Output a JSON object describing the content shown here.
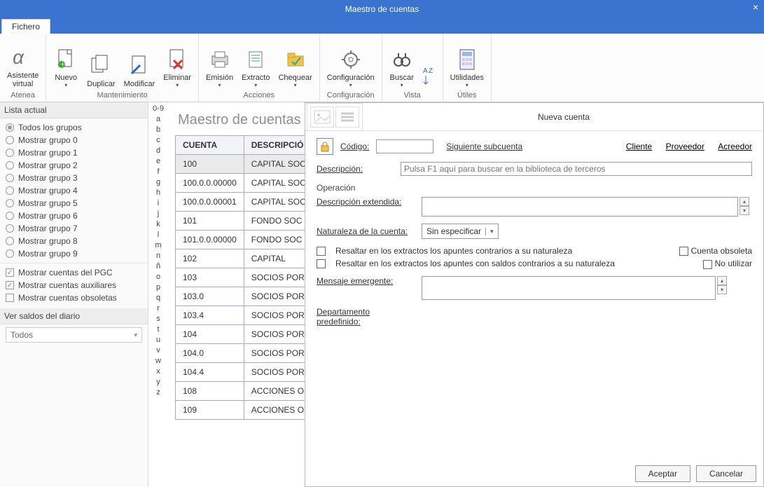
{
  "titlebar": {
    "title": "Maestro de cuentas"
  },
  "tabs": [
    {
      "label": "Fichero"
    }
  ],
  "ribbon": {
    "groups": [
      {
        "title": "Atenea",
        "items": [
          {
            "label": "Asistente\nvirtual",
            "icon": "alpha"
          }
        ]
      },
      {
        "title": "Mantenimiento",
        "items": [
          {
            "label": "Nuevo",
            "icon": "doc-plus",
            "dd": true
          },
          {
            "label": "Duplicar",
            "icon": "doc-dup"
          },
          {
            "label": "Modificar",
            "icon": "doc-edit"
          },
          {
            "label": "Eliminar",
            "icon": "doc-del",
            "dd": true
          }
        ]
      },
      {
        "title": "Acciones",
        "items": [
          {
            "label": "Emisión",
            "icon": "emit",
            "dd": true
          },
          {
            "label": "Extracto",
            "icon": "extract",
            "dd": true
          },
          {
            "label": "Chequear",
            "icon": "check",
            "dd": true
          }
        ]
      },
      {
        "title": "Configuración",
        "items": [
          {
            "label": "Configuración",
            "icon": "gear",
            "dd": true
          }
        ]
      },
      {
        "title": "Vista",
        "items": [
          {
            "label": "Buscar",
            "icon": "binoc",
            "dd": true
          },
          {
            "label": "",
            "icon": "sort"
          }
        ]
      },
      {
        "title": "Útiles",
        "items": [
          {
            "label": "Utilidades",
            "icon": "calc",
            "dd": true
          }
        ]
      }
    ]
  },
  "left": {
    "header": "Lista actual",
    "radios": [
      "Todos los grupos",
      "Mostrar grupo 0",
      "Mostrar grupo 1",
      "Mostrar grupo 2",
      "Mostrar grupo 3",
      "Mostrar grupo 4",
      "Mostrar grupo 5",
      "Mostrar grupo 6",
      "Mostrar grupo 7",
      "Mostrar grupo 8",
      "Mostrar grupo 9"
    ],
    "selected_radio": 0,
    "checks": [
      {
        "label": "Mostrar cuentas del PGC",
        "on": true
      },
      {
        "label": "Mostrar cuentas auxiliares",
        "on": true
      },
      {
        "label": "Mostrar cuentas obsoletas",
        "on": false
      }
    ],
    "diario_header": "Ver saldos del diario",
    "diario_value": "Todos"
  },
  "alpha": [
    "0-9",
    "a",
    "b",
    "c",
    "d",
    "e",
    "f",
    "g",
    "h",
    "i",
    "j",
    "k",
    "l",
    "m",
    "n",
    "ñ",
    "o",
    "p",
    "q",
    "r",
    "s",
    "t",
    "u",
    "v",
    "w",
    "x",
    "y",
    "z"
  ],
  "grid": {
    "title": "Maestro de cuentas",
    "headers": [
      "CUENTA",
      "DESCRIPCIÓ"
    ],
    "rows": [
      {
        "c": "100",
        "d": "CAPITAL SOC",
        "sel": true
      },
      {
        "c": "100.0.0.00000",
        "d": "CAPITAL SOC"
      },
      {
        "c": "100.0.0.00001",
        "d": "CAPITAL SOC"
      },
      {
        "c": "101",
        "d": "FONDO SOC"
      },
      {
        "c": "101.0.0.00000",
        "d": "FONDO SOC"
      },
      {
        "c": "102",
        "d": "CAPITAL"
      },
      {
        "c": "103",
        "d": "SOCIOS POR"
      },
      {
        "c": "103.0",
        "d": "SOCIOS POR"
      },
      {
        "c": "103.4",
        "d": "SOCIOS POR"
      },
      {
        "c": "104",
        "d": "SOCIOS POR"
      },
      {
        "c": "104.0",
        "d": "SOCIOS POR"
      },
      {
        "c": "104.4",
        "d": "SOCIOS POR"
      },
      {
        "c": "108",
        "d": "ACCIONES O"
      },
      {
        "c": "109",
        "d": "ACCIONES O"
      }
    ]
  },
  "modal": {
    "title": "Nueva cuenta",
    "codigo_label": "Código:",
    "siguiente": "Siguiente subcuenta",
    "links": [
      "Cliente",
      "Proveedor",
      "Acreedor"
    ],
    "descripcion_label": "Descripción:",
    "descripcion_ph": "Pulsa F1 aquí para buscar en la biblioteca de terceros",
    "operacion": "Operación",
    "desc_ext": "Descripción extendida:",
    "naturaleza_label": "Naturaleza de la cuenta:",
    "naturaleza_value": "Sin especificar",
    "chk1": "Resaltar en los extractos los apuntes contrarios a su naturaleza",
    "chk2": "Resaltar en los extractos los apuntes con saldos contrarios a su naturaleza",
    "obsoleta": "Cuenta obsoleta",
    "noutilizar": "No utilizar",
    "mensaje_label": "Mensaje emergente:",
    "departamento": "Departamento predefinido:",
    "aceptar": "Aceptar",
    "cancelar": "Cancelar"
  }
}
